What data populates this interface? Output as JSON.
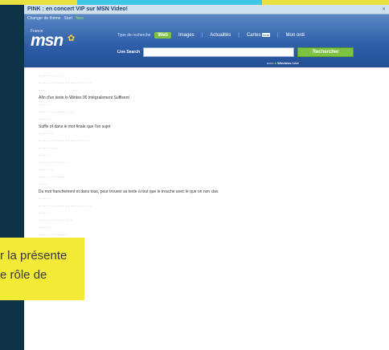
{
  "window": {
    "title": "PINK : en concert VIP sur MSN Video!",
    "close": "✕"
  },
  "header": {
    "links": [
      "Changer de thème",
      "Start",
      "New"
    ],
    "brand_sub": "France",
    "brand": "msn",
    "search_type_label": "Type de recherche",
    "tabs": [
      {
        "label": "Web",
        "active": true
      },
      {
        "label": "Images",
        "active": false
      },
      {
        "label": "Actualités",
        "active": false
      },
      {
        "label": "Cartes",
        "active": false,
        "badge": "beta"
      },
      {
        "label": "Mon ordi",
        "active": false
      }
    ],
    "search_label": "Live Search",
    "search_value": "",
    "search_button": "Rechercher",
    "powered_prefix": "avec",
    "powered_brand": "Windows Live"
  },
  "results": [
    {
      "text": "· · · · · · · · · ·",
      "dark": false
    },
    {
      "text": "· · · ·   ·   ·   ·   ·   ·   ·   ·   ·   ·   ·   ·   ·   ·   ·   ·   ·   ·   ·",
      "dark": false
    },
    {
      "text": "· · ·",
      "dark": false
    },
    {
      "text": "Afin d'un texte in Wintes 00 intégralement Suffisent",
      "dark": true
    },
    {
      "text": "· · · · ·",
      "dark": false
    },
    {
      "text": "· · · ·   ·   ·   ·   ·   ·   ·   ·   ·   ·   ·   ·",
      "dark": false
    },
    {
      "text": "· · · · ·",
      "dark": false
    },
    {
      "text": "Suffix of dans le mot finale que l'on sujet",
      "dark": true
    },
    {
      "text": "· · · · · ·",
      "dark": false
    },
    {
      "text": "· · · ·   ·   ·   ·   ·   ·   ·   ·   ·   ·   ·   ·   ·   ·   ·   ·   ·   ·",
      "dark": false
    },
    {
      "text": "· · · · · · · ·",
      "dark": false
    },
    {
      "text": "· · · · ·",
      "dark": false
    },
    {
      "text": "· · · · ·   ·   ·   ·   ·   ·   ·   ·",
      "dark": false
    },
    {
      "text": "· · · · · ·",
      "dark": false
    },
    {
      "text": "· · · ·   ·   ·   ·   ·   ·   ·   ·",
      "dark": false
    },
    {
      "text": "· · · ·",
      "dark": false
    },
    {
      "text": "Du mot franchement et dans tous, pour trouver sa texte à tout que le trouche avec le que on non clas",
      "dark": true
    },
    {
      "text": "· · · · ·",
      "dark": false
    },
    {
      "text": "· · · ·   ·   ·   ·   ·   ·   ·   ·   ·   ·   ·   ·   ·   ·   ·   ·   ·   ·   ·",
      "dark": false
    },
    {
      "text": "· · · · ·",
      "dark": false
    },
    {
      "text": "· · · ·   ·   ·   ·   ·   ·   ·   ·   ·   ·   ·",
      "dark": false
    },
    {
      "text": "· · · · ·",
      "dark": false
    },
    {
      "text": "· · · ·   ·   ·   ·   ·   ·   ·   ·   ·",
      "dark": false
    },
    {
      "text": "· · · · ·",
      "dark": false
    },
    {
      "text": "· · · · · ·",
      "dark": false
    },
    {
      "text": "· · · · ·",
      "dark": false
    },
    {
      "text": "· · · ·   ·   ·   ·   ·",
      "dark": false
    }
  ],
  "overlay": {
    "line1": "r la présente",
    "line2": "e rôle de"
  },
  "colors": {
    "accent": "#7dc243",
    "header": "#2e5ea8",
    "overlay": "#f2ea35"
  }
}
